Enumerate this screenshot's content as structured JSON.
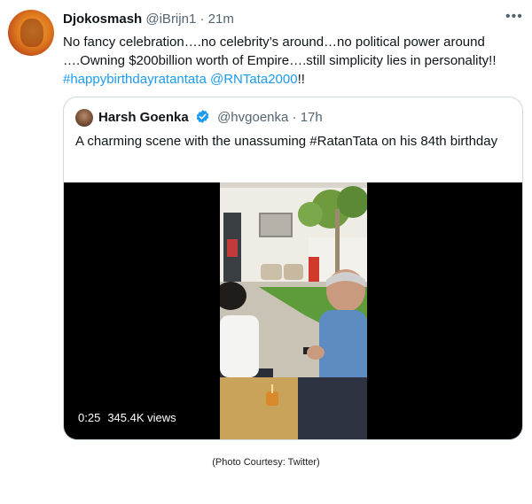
{
  "tweet": {
    "author_name": "Djokosmash",
    "handle": "@iBrijn1",
    "separator": "·",
    "time": "21m",
    "more_icon": "more-icon",
    "text_line1": "No fancy celebration….no celebrity’s around…no political power around",
    "text_line2": "….Owning $200billion  worth of Empire….still simplicity lies in personality!!",
    "hashtag": "#happybirthdayratantata",
    "mention": "@RNTata2000",
    "text_end": "!!"
  },
  "quoted": {
    "author_name": "Harsh Goenka",
    "handle": "@hvgoenka",
    "separator": "·",
    "time": "17h",
    "text": "A charming scene with the unassuming #RatanTata on his 84th birthday",
    "video": {
      "duration": "0:25",
      "views": "345.4K views"
    }
  },
  "caption": "(Photo Courtesy: Twitter)",
  "colors": {
    "link": "#1d9bf0",
    "secondary_text": "#536471",
    "border": "#cfd9de",
    "verified": "#1d9bf0"
  }
}
